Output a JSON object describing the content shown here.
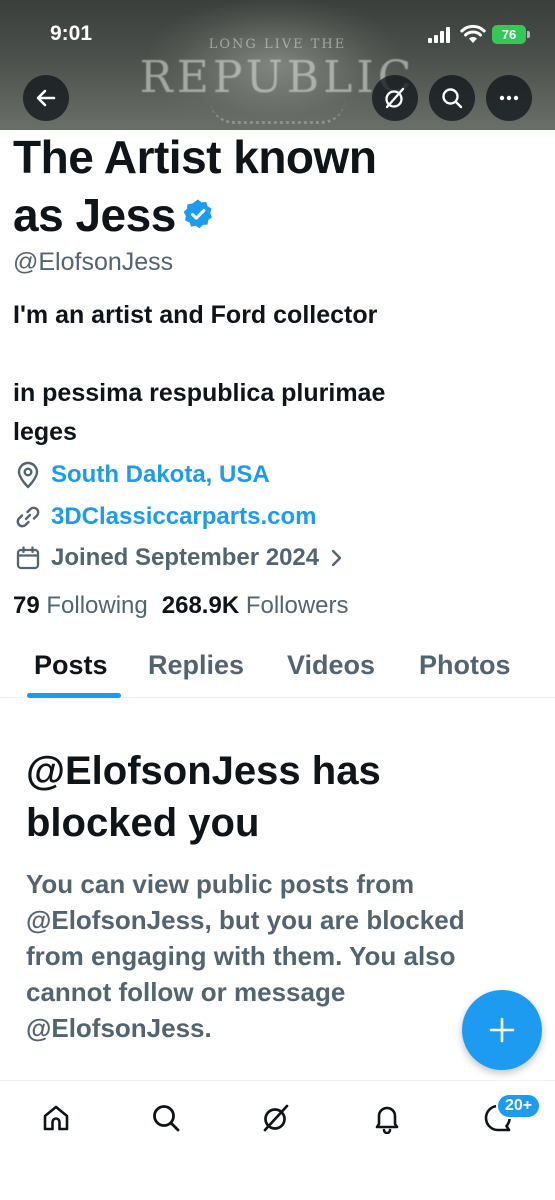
{
  "status_bar": {
    "time": "9:01",
    "battery": "76"
  },
  "banner": {
    "line1": "LONG LIVE THE",
    "line2": "REPUBLIC"
  },
  "header_buttons": {
    "back_icon": "arrow-left-icon",
    "grok_icon": "grok-icon",
    "search_icon": "search-icon",
    "more_icon": "more-icon"
  },
  "profile": {
    "name_line1": "The Artist known",
    "name_line2": "as Jess",
    "handle": "@ElofsonJess",
    "bio_line1": "I'm an artist and Ford collector",
    "bio_line2": "in pessima respublica plurimae",
    "bio_line3": "leges",
    "location": "South Dakota, USA",
    "website": "3DClassiccarparts.com",
    "joined": "Joined September 2024",
    "following_count": "79",
    "following_label": "Following",
    "followers_count": "268.9K",
    "followers_label": "Followers"
  },
  "tabs": [
    {
      "label": "Posts",
      "active": true
    },
    {
      "label": "Replies",
      "active": false
    },
    {
      "label": "Videos",
      "active": false
    },
    {
      "label": "Photos",
      "active": false
    }
  ],
  "blocked": {
    "title_line1": "@ElofsonJess has",
    "title_line2": "blocked you",
    "body_line1": "You can view public posts from",
    "body_line2": "@ElofsonJess, but you are blocked",
    "body_line3": "from engaging with them. You also",
    "body_line4": "cannot follow or message",
    "body_line5": "@ElofsonJess."
  },
  "fab": {
    "label": "+"
  },
  "bottom_nav": {
    "items": [
      "home-icon",
      "search-icon",
      "grok-icon",
      "notifications-icon",
      "messages-icon"
    ],
    "badge": "20+"
  },
  "colors": {
    "accent": "#1d9bf0",
    "text": "#0f1419",
    "muted": "#536471",
    "battery": "#34c759"
  }
}
